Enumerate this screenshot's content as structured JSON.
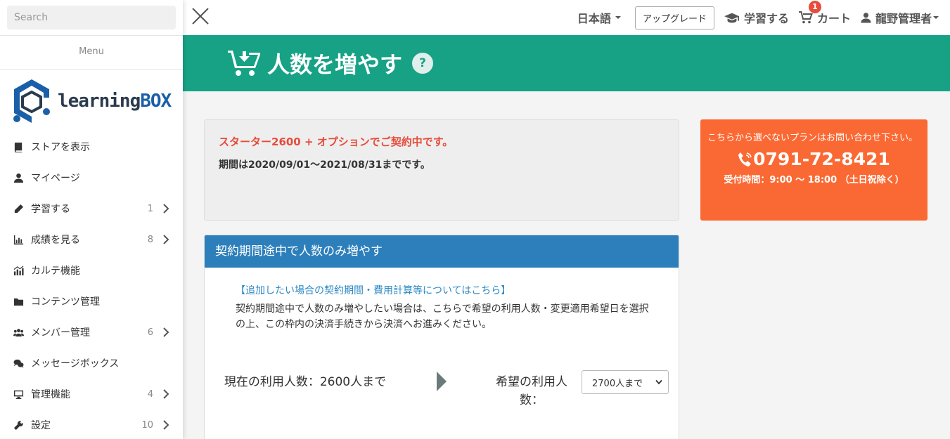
{
  "sidebar": {
    "search_placeholder": "Search",
    "menu_heading": "Menu",
    "logo": {
      "prefix": "learning",
      "suffix": "BOX"
    },
    "items": [
      {
        "label": "ストアを表示",
        "count": ""
      },
      {
        "label": "マイページ",
        "count": ""
      },
      {
        "label": "学習する",
        "count": "1"
      },
      {
        "label": "成績を見る",
        "count": "8"
      },
      {
        "label": "カルテ機能",
        "count": ""
      },
      {
        "label": "コンテンツ管理",
        "count": ""
      },
      {
        "label": "メンバー管理",
        "count": "6"
      },
      {
        "label": "メッセージボックス",
        "count": ""
      },
      {
        "label": "管理機能",
        "count": "4"
      },
      {
        "label": "設定",
        "count": "10"
      }
    ]
  },
  "topbar": {
    "language": "日本語",
    "upgrade_label": "アップグレード",
    "learn_label": "学習する",
    "cart_label": "カート",
    "cart_count": "1",
    "user_label": "龍野管理者"
  },
  "header": {
    "title": "人数を増やす",
    "help_label": "?"
  },
  "contract": {
    "plan": "スターター2600 + オプションでご契約中です。",
    "period": "期間は2020/09/01～2021/08/31までです。"
  },
  "contact": {
    "note": "こちらから選べないプランはお問い合わせ下さい。",
    "phone": "0791-72-8421",
    "hours": "受付時間：9:00 ～ 18:00 （土日祝除く）"
  },
  "panel": {
    "title": "契約期間途中で人数のみ増やす",
    "link": "【追加したい場合の契約期間・費用計算等についてはこちら】",
    "description": "契約期間途中で人数のみ増やしたい場合は、こちらで希望の利用人数・変更適用希望日を選択の上、この枠内の決済手続きから決済へお進みください。",
    "current_count": "現在の利用人数：2600人まで",
    "wish_label": "希望の利用人数：",
    "wish_selected": "2700人まで"
  },
  "colors": {
    "banner": "#17a286",
    "panel_header": "#2c7fbb",
    "contact": "#fa6933",
    "alert_text": "#e74c3c"
  }
}
